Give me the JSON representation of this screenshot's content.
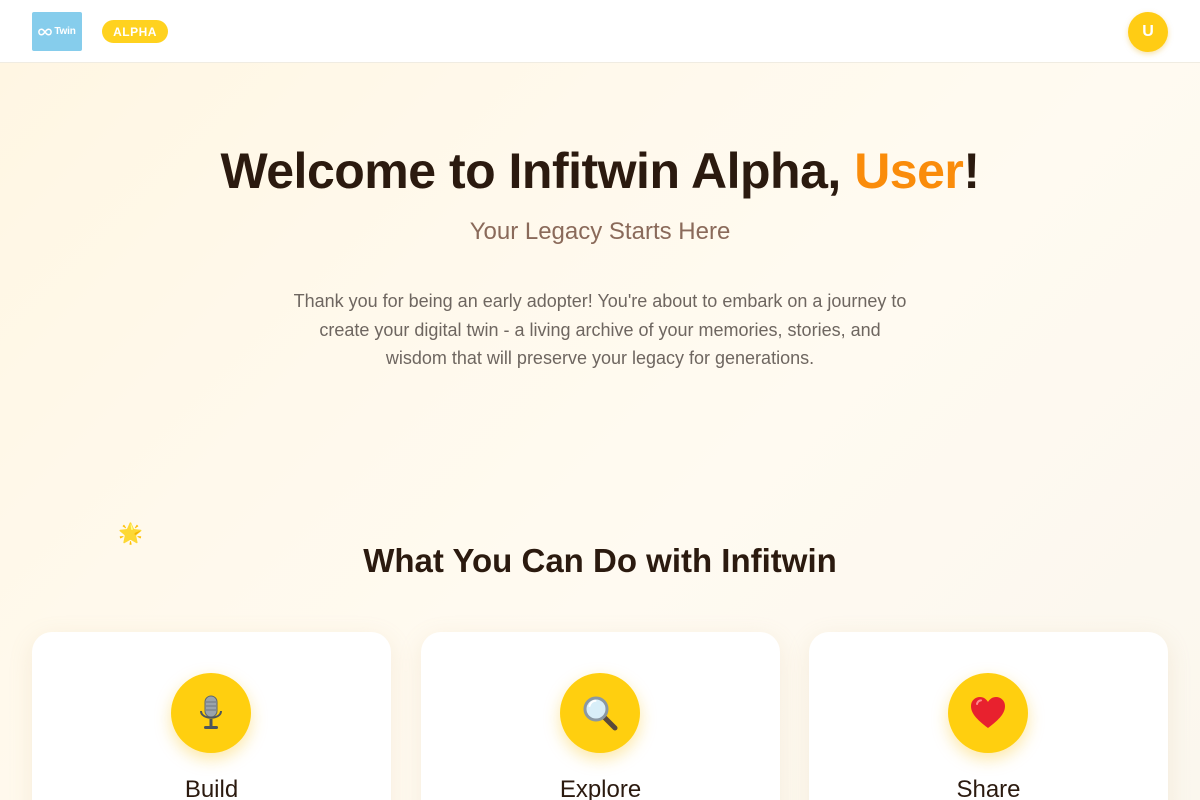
{
  "header": {
    "logo_text": "Twin",
    "badge": "ALPHA",
    "avatar_initial": "U"
  },
  "hero": {
    "title_prefix": "Welcome to Infitwin Alpha, ",
    "user_name": "User",
    "title_suffix": "!",
    "subtitle": "Your Legacy Starts Here",
    "description": "Thank you for being an early adopter! You're about to embark on a journey to create your digital twin - a living archive of your memories, stories, and wisdom that will preserve your legacy for generations."
  },
  "decoration": {
    "sparkle": "🌟"
  },
  "features": {
    "title": "What You Can Do with Infitwin",
    "cards": [
      {
        "icon": "microphone-icon",
        "title": "Build"
      },
      {
        "icon": "magnifier-icon",
        "title": "Explore"
      },
      {
        "icon": "heart-icon",
        "title": "Share"
      }
    ]
  },
  "colors": {
    "accent_yellow": "#ffd21f",
    "name_orange": "#fa8c0b",
    "logo_blue": "#86cdec",
    "heading": "#2b1a0f"
  }
}
